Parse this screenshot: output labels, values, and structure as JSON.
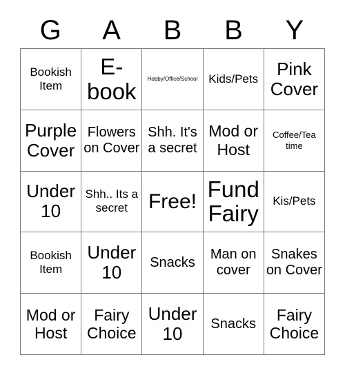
{
  "card": {
    "header_letters": [
      "G",
      "A",
      "B",
      "B",
      "Y"
    ],
    "rows": [
      [
        {
          "text": "Bookish Item",
          "size": "fs-s"
        },
        {
          "text": "E-book",
          "size": "fs-huge"
        },
        {
          "text": "Hobby/Office/School",
          "size": "fs-xxs"
        },
        {
          "text": "Kids/Pets",
          "size": "fs-s"
        },
        {
          "text": "Pink Cover",
          "size": "fs-xl"
        }
      ],
      [
        {
          "text": "Purple Cover",
          "size": "fs-xl"
        },
        {
          "text": "Flowers on Cover",
          "size": "fs-m"
        },
        {
          "text": "Shh. It's a secret",
          "size": "fs-m"
        },
        {
          "text": "Mod or Host",
          "size": "fs-l"
        },
        {
          "text": "Coffee/Tea time",
          "size": "fs-xs"
        }
      ],
      [
        {
          "text": "Under 10",
          "size": "fs-xl"
        },
        {
          "text": "Shh.. Its a secret",
          "size": "fs-s"
        },
        {
          "text": "Free!",
          "size": "fs-xxl"
        },
        {
          "text": "Fund Fairy",
          "size": "fs-huge"
        },
        {
          "text": "Kis/Pets",
          "size": "fs-s"
        }
      ],
      [
        {
          "text": "Bookish Item",
          "size": "fs-s"
        },
        {
          "text": "Under 10",
          "size": "fs-xl"
        },
        {
          "text": "Snacks",
          "size": "fs-m"
        },
        {
          "text": "Man on cover",
          "size": "fs-m"
        },
        {
          "text": "Snakes on Cover",
          "size": "fs-m"
        }
      ],
      [
        {
          "text": "Mod or Host",
          "size": "fs-l"
        },
        {
          "text": "Fairy Choice",
          "size": "fs-l"
        },
        {
          "text": "Under 10",
          "size": "fs-xl"
        },
        {
          "text": "Snacks",
          "size": "fs-m"
        },
        {
          "text": "Fairy Choice",
          "size": "fs-l"
        }
      ]
    ],
    "colors": {
      "background": "#ffffff",
      "text": "#000000",
      "grid_line": "#7a7a7a"
    }
  }
}
